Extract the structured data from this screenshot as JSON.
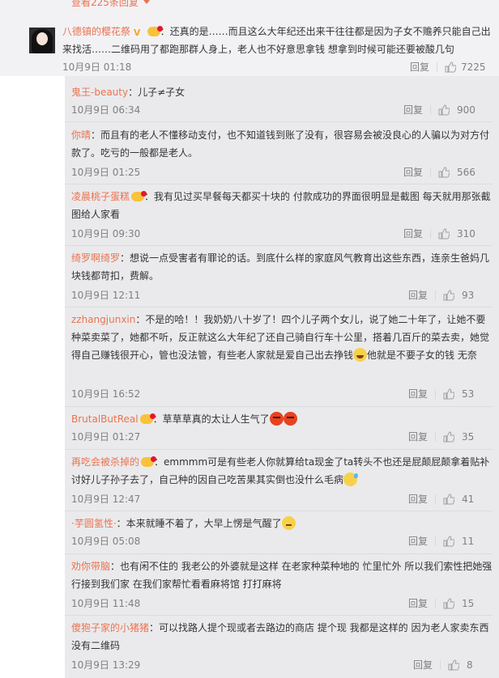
{
  "top": {
    "more_text": "查看225条回复"
  },
  "main": {
    "user": "八德镇的樱花祭",
    "text": "：还真的是……而且这么大年纪还出来干往往都是因为子女不赡养只能自己出来找活……二维码用了都跑那群人身上，老人也不好意思拿钱 想拿到时候可能还要被酸几句",
    "date": "10月9日 01:18",
    "reply": "回复",
    "likes": "7225"
  },
  "replies": [
    {
      "user": "鬼王-beauty",
      "text": "：儿子≠子女",
      "date": "10月9日 06:34",
      "reply": "回复",
      "likes": "900"
    },
    {
      "user": "你晴",
      "text": "：而且有的老人不懂移动支付，也不知道钱到账了没有，很容易会被没良心的人骗以为对方付款了。吃亏的一般都是老人。",
      "date": "10月9日 01:25",
      "reply": "回复",
      "likes": "566"
    },
    {
      "user": "凌晨桃子蛋糕",
      "text": "：我有见过买早餐每天都买十块的 付款成功的界面很明显是截图 每天就用那张截图给人家看",
      "date": "10月9日 09:30",
      "reply": "回复",
      "likes": "310"
    },
    {
      "user": "绮罗啊绮罗",
      "text": "：想说一点受害者有罪论的话。到底什么样的家庭风气教育出这些东西，连亲生爸妈几块钱都苛扣，费解。",
      "date": "10月9日 12:11",
      "reply": "回复",
      "likes": "93"
    },
    {
      "user": "zzhangjunxin",
      "text": "：不是的哈！！我奶奶八十岁了！四个儿子两个女儿，说了她二十年了，让她不要种菜卖菜了，她都不听，反正就这么大年纪了还自己骑自行车十公里，搭着几百斤的菜去卖，她觉得自己赚钱很开心，管也没法管，有些老人家就是爱自己出去挣钱",
      "text2": "他就是不要子女的钱 无奈",
      "date": "10月9日 16:52",
      "reply": "回复",
      "likes": "53"
    },
    {
      "user": "BrutalButReal",
      "text": "：草草草真的太让人生气了",
      "date": "10月9日 01:27",
      "reply": "回复",
      "likes": "35"
    },
    {
      "user": "再吃会被杀掉的",
      "text": "：emmmm可是有些老人你就算给ta现金了ta转头不也还是屁颠屁颠拿着贴补讨好儿子孙子去了，自己种的因自己吃苦果其实倒也没什么毛病",
      "date": "10月9日 12:47",
      "reply": "回复",
      "likes": "41"
    },
    {
      "user": "·芋圆氢性·",
      "text": "：本来就睡不着了，大早上愣是气醒了",
      "date": "10月9日 05:08",
      "reply": "回复",
      "likes": "11"
    },
    {
      "user": "劝你带脑",
      "text": "：也有闲不住的 我老公的外婆就是这样 在老家种菜种地的 忙里忙外 所以我们索性把她强行接到我们家 在我们家帮忙看看麻将馆 打打麻将",
      "date": "10月9日 11:48",
      "reply": "回复",
      "likes": "15"
    },
    {
      "user": "傻狍子家的小猪猪",
      "text": "：可以找路人提个现或者去路边的商店 提个现 我都是这样的 因为老人家卖东西没有二维码",
      "date": "10月9日 13:29",
      "reply": "回复",
      "likes": "8"
    }
  ],
  "icons": {
    "like": "thumbs-up-icon",
    "accent": "#eb7350",
    "meta_gray": "#808080"
  }
}
